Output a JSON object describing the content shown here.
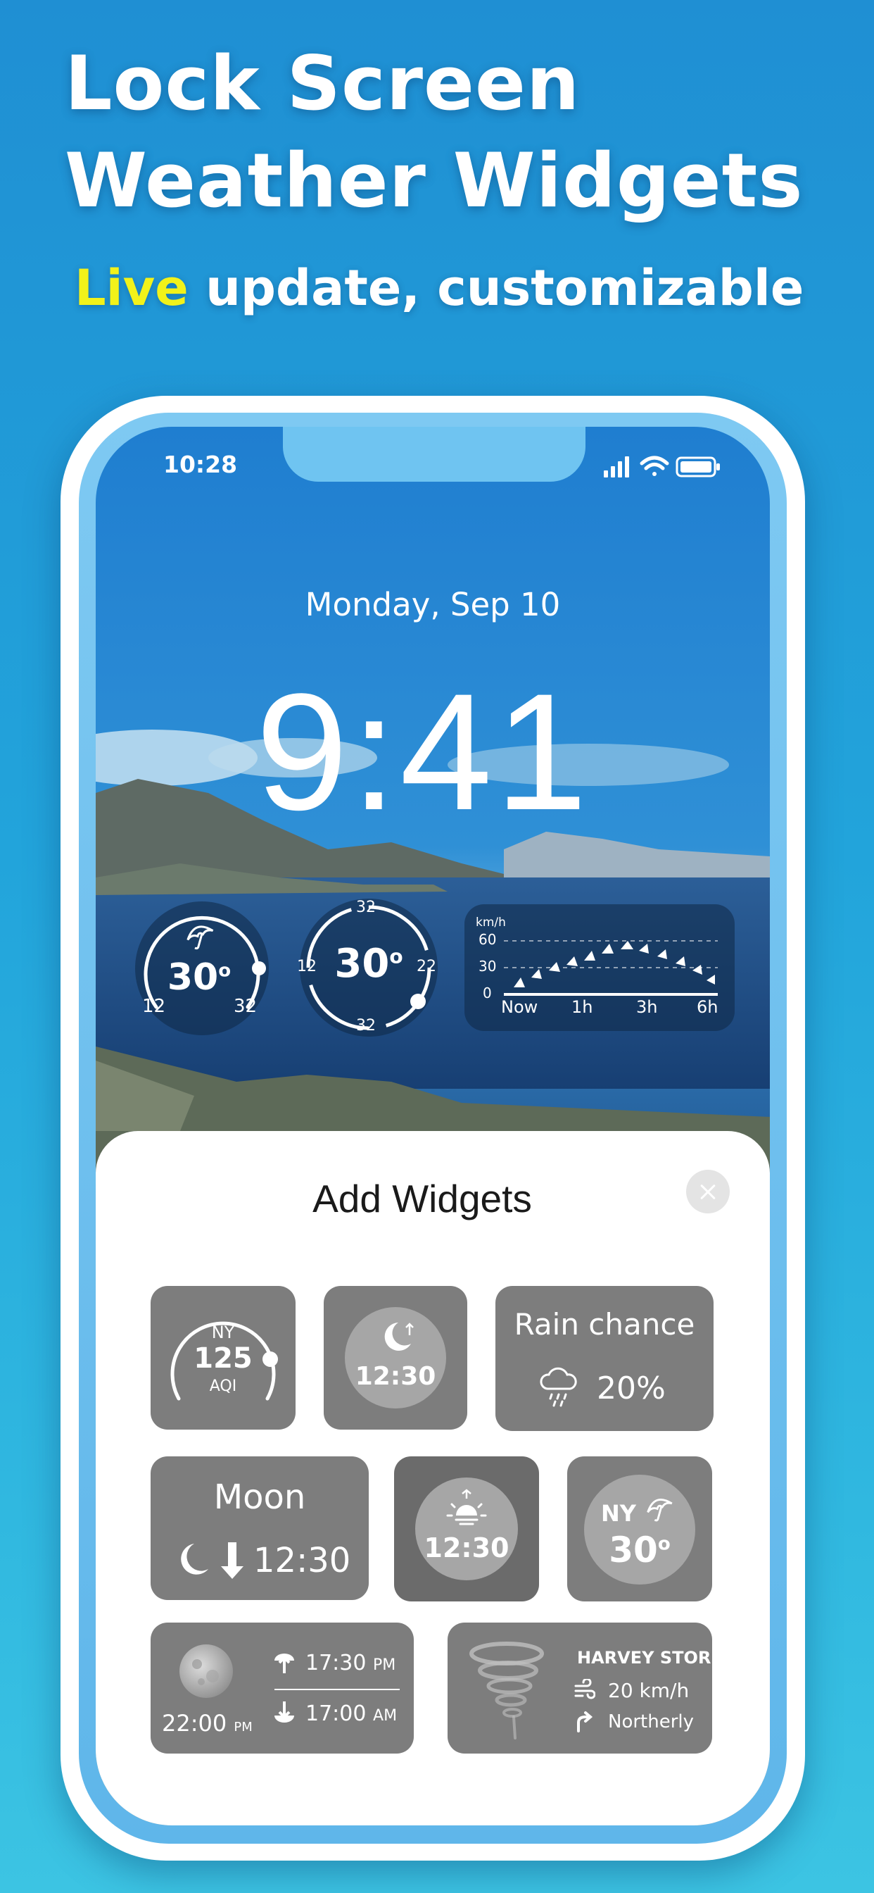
{
  "headline": {
    "line1": "Lock Screen",
    "line2": "Weather Widgets",
    "sub_highlight": "Live",
    "sub_rest": "update, customizable"
  },
  "status_bar": {
    "time": "10:28",
    "icons": [
      "signal-icon",
      "wifi-icon",
      "battery-icon"
    ]
  },
  "lock_screen": {
    "date": "Monday, Sep 10",
    "time": "9:41"
  },
  "lock_widgets": {
    "gauge1": {
      "temp": "30",
      "unit": "o",
      "low": "12",
      "high": "32",
      "icon": "umbrella-icon",
      "level": 0.85
    },
    "gauge2": {
      "temp": "30",
      "unit": "o",
      "top": "32",
      "bottom": "32",
      "left": "12",
      "right": "22",
      "level": 0.6
    },
    "wind_chart": {
      "unit": "km/h",
      "y_ticks": [
        "60",
        "30",
        "0"
      ],
      "x_ticks": [
        "Now",
        "1h",
        "3h",
        "6h"
      ]
    }
  },
  "sheet": {
    "title": "Add Widgets",
    "close_icon": "close-icon"
  },
  "widgets": {
    "aqi": {
      "city": "NY",
      "value": "125",
      "label": "AQI",
      "level": 0.8
    },
    "moonrise": {
      "time": "12:30",
      "icon": "moon-icon"
    },
    "rain": {
      "title": "Rain chance",
      "value": "20%",
      "icon": "rain-cloud-icon"
    },
    "moon": {
      "title": "Moon",
      "time": "12:30",
      "icon": "moon-set-icon"
    },
    "sunrise": {
      "time": "12:30",
      "icon": "sunrise-icon"
    },
    "ny_temp": {
      "city": "NY",
      "temp": "30",
      "unit": "o",
      "icon": "umbrella-icon"
    },
    "moon_phase": {
      "time": "22:00",
      "time_suffix": "PM",
      "rise_time": "17:30",
      "rise_suffix": "PM",
      "set_time": "17:00",
      "set_suffix": "AM"
    },
    "storm": {
      "name": "HARVEY STORM",
      "speed": "20 km/h",
      "direction": "Northerly"
    }
  },
  "colors": {
    "background": "#22a4db",
    "highlight": "#f2f21a",
    "tile_gray": "#7d7d7d"
  }
}
